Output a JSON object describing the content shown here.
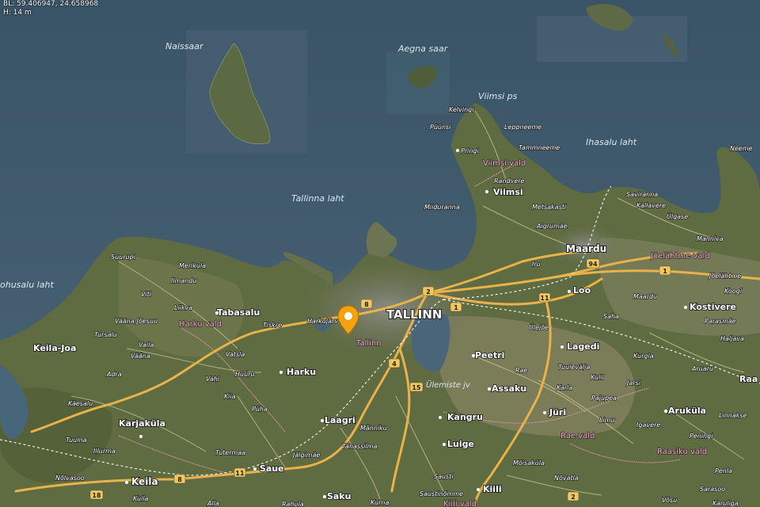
{
  "readout": {
    "coords": "BL: 59.406947, 24.658968",
    "height": "H: 14 m"
  },
  "colors": {
    "sea": "#3f5c70",
    "land": "#5d6a3e",
    "road": "#e7b24a",
    "pin": "#f4a30f",
    "district": "#e89aa8"
  },
  "labels": {
    "water": [
      "Naissaar",
      "Aegna saar",
      "Viimsi ps",
      "Ihasalu laht",
      "Tallinna laht",
      "ohusalu laht"
    ],
    "major": [
      "TALLINN",
      "Tallinn",
      "Maardu",
      "Keila"
    ],
    "districts": [
      "Viimsi vald",
      "Harku vald",
      "Jõelähtme vald",
      "Rae vald",
      "Raasiku vald",
      "Kiili vald"
    ],
    "places": [
      "Kelvingi",
      "Püünsi",
      "Leppneeme",
      "Pringi",
      "Tammneeme",
      "Randvere",
      "Viimsi",
      "Miiduranna",
      "Metsakasti",
      "Aigrumäe",
      "Saviranna",
      "Kallavere",
      "Ülgase",
      "Neeme",
      "Manniva",
      "Jõelähtme",
      "Koogi",
      "Iru",
      "Loo",
      "Maardu",
      "Kostivere",
      "Parasmäe",
      "Haljava",
      "Saha",
      "Ülejõe",
      "Lagedi",
      "Kurgla",
      "Aruaru",
      "Rae",
      "Peetri",
      "Tuulevälja",
      "Kulli",
      "Jarsi",
      "Raa",
      "Ülemiste jv",
      "Assaku",
      "Karla",
      "Pajupea",
      "Aruküla",
      "Linnakse",
      "Jüri",
      "Limu",
      "Igavere",
      "Peningi",
      "Suurupi",
      "Merikula",
      "Ilmandu",
      "Viti",
      "Liikva",
      "Tabasalu",
      "Tiskre",
      "Harkujärv",
      "Vääna-Jõesuu",
      "Tursalu",
      "Vaila",
      "Vääna",
      "Vatsla",
      "Harku",
      "Adra",
      "Vahi",
      "Hüüru",
      "Kiia",
      "Keila-Joa",
      "Käesalu",
      "Püha",
      "Karjaküla",
      "Laagri",
      "Männiku",
      "Kangru",
      "Luige",
      "Tuulna",
      "Illurma",
      "Tutermaa",
      "Jälgimäe",
      "Tanassilma",
      "Saue",
      "Saustinõmme",
      "Möisaküla",
      "Sausti",
      "Kiili",
      "Nõlvasoo",
      "Penla",
      "Kuila",
      "Alla",
      "Saku",
      "Rahula",
      "Sarasoo",
      "Võsu",
      "Nõvatla",
      "Kurna",
      "Karuliga"
    ]
  },
  "route_numbers": [
    "8",
    "2",
    "1",
    "94",
    "11",
    "4",
    "15",
    "8",
    "11",
    "18",
    "2",
    "1"
  ]
}
